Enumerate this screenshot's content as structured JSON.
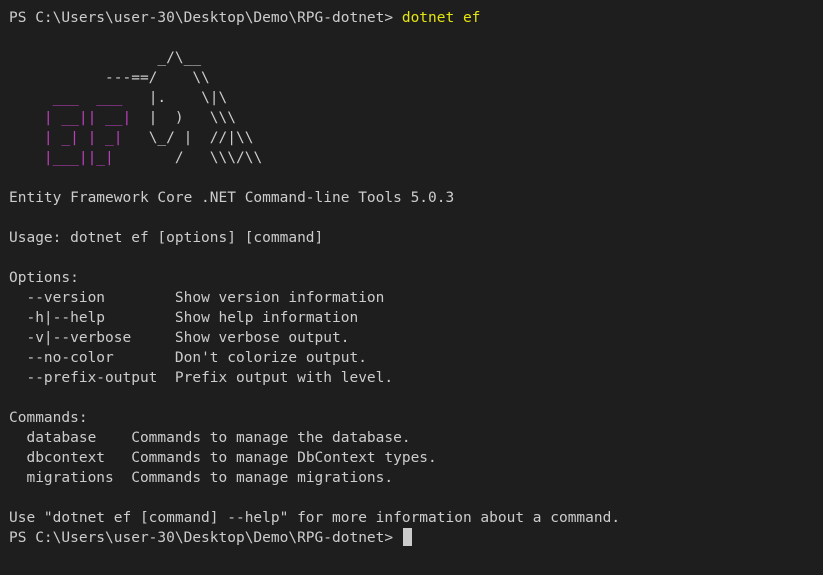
{
  "prompt1": {
    "path": "PS C:\\Users\\user-30\\Desktop\\Demo\\RPG-dotnet> ",
    "command": "dotnet ef"
  },
  "logo": {
    "lines": [
      {
        "ef": "",
        "rest": "                 _/\\__"
      },
      {
        "ef": "",
        "rest": "           ---==/    \\\\"
      },
      {
        "ef": "     ___  ___",
        "rest": "   |.    \\|\\"
      },
      {
        "ef": "    | __|| __|",
        "rest": "  |  )   \\\\\\"
      },
      {
        "ef": "    | _| | _|",
        "rest": "   \\_/ |  //|\\\\"
      },
      {
        "ef": "    |___||_|",
        "rest": "       /   \\\\\\/\\\\"
      }
    ]
  },
  "title_line": "Entity Framework Core .NET Command-line Tools 5.0.3",
  "usage_line": "Usage: dotnet ef [options] [command]",
  "options": {
    "header": "Options:",
    "items": [
      {
        "flag": "  --version        ",
        "desc": "Show version information"
      },
      {
        "flag": "  -h|--help        ",
        "desc": "Show help information"
      },
      {
        "flag": "  -v|--verbose     ",
        "desc": "Show verbose output."
      },
      {
        "flag": "  --no-color       ",
        "desc": "Don't colorize output."
      },
      {
        "flag": "  --prefix-output  ",
        "desc": "Prefix output with level."
      }
    ]
  },
  "commands": {
    "header": "Commands:",
    "items": [
      {
        "name": "  database    ",
        "desc": "Commands to manage the database."
      },
      {
        "name": "  dbcontext   ",
        "desc": "Commands to manage DbContext types."
      },
      {
        "name": "  migrations  ",
        "desc": "Commands to manage migrations."
      }
    ]
  },
  "footer_line": "Use \"dotnet ef [command] --help\" for more information about a command.",
  "prompt2": {
    "path": "PS C:\\Users\\user-30\\Desktop\\Demo\\RPG-dotnet> "
  },
  "colors": {
    "background": "#1e1e1e",
    "text": "#cccccc",
    "command": "#e5e510",
    "logo_accent": "#bc3fbc"
  }
}
